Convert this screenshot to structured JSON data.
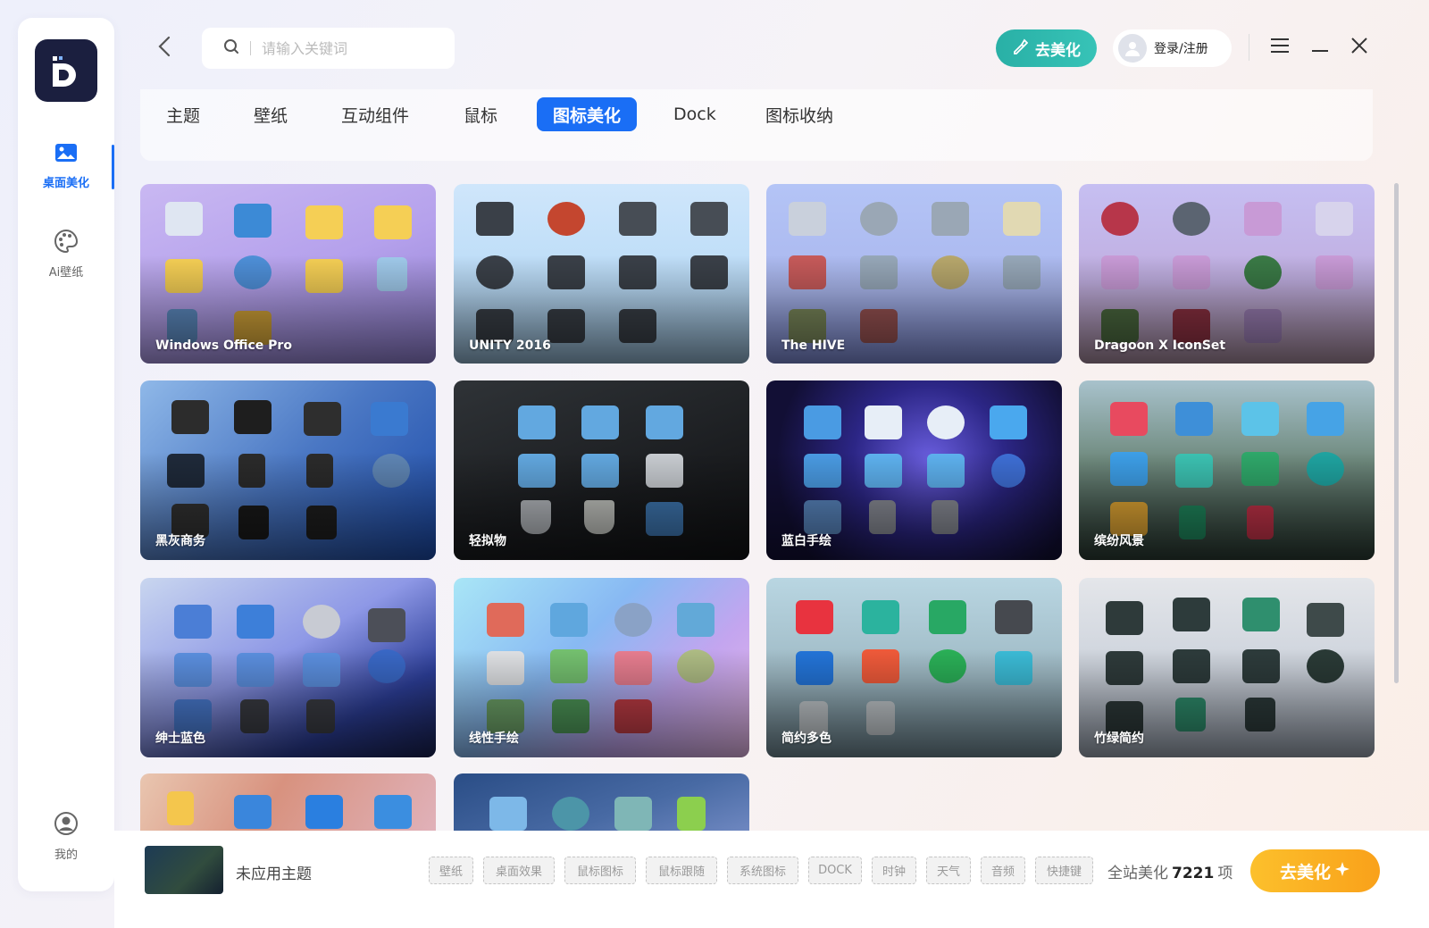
{
  "sidebar": {
    "items": [
      {
        "label": "桌面美化",
        "icon": "image-icon"
      },
      {
        "label": "Ai壁纸",
        "icon": "palette-icon"
      }
    ],
    "profile_label": "我的"
  },
  "header": {
    "search_placeholder": "请输入关键词",
    "beautify_label": "去美化",
    "login_label": "登录/注册"
  },
  "tabs": [
    "主题",
    "壁纸",
    "互动组件",
    "鼠标",
    "图标美化",
    "Dock",
    "图标收纳"
  ],
  "active_tab": "图标美化",
  "cards": [
    {
      "title": "Windows Office Pro"
    },
    {
      "title": "UNITY 2016"
    },
    {
      "title": "The HIVE"
    },
    {
      "title": "Dragoon X IconSet"
    },
    {
      "title": "黑灰商务"
    },
    {
      "title": "轻拟物"
    },
    {
      "title": "蓝白手绘"
    },
    {
      "title": "缤纷风景"
    },
    {
      "title": "绅士蓝色"
    },
    {
      "title": "线性手绘"
    },
    {
      "title": "简约多色"
    },
    {
      "title": "竹绿简约"
    }
  ],
  "bottom": {
    "status": "未应用主题",
    "chips": [
      "壁纸",
      "桌面效果",
      "鼠标图标",
      "鼠标跟随",
      "系统图标",
      "DOCK",
      "时钟",
      "天气",
      "音频",
      "快捷键"
    ],
    "total_prefix": "全站美化",
    "total_count": "7221",
    "total_suffix": "项",
    "apply_label": "去美化"
  },
  "colors": {
    "accent": "#1a6ef5",
    "teal": "#2fb8ad",
    "gold": "#fbb424"
  }
}
